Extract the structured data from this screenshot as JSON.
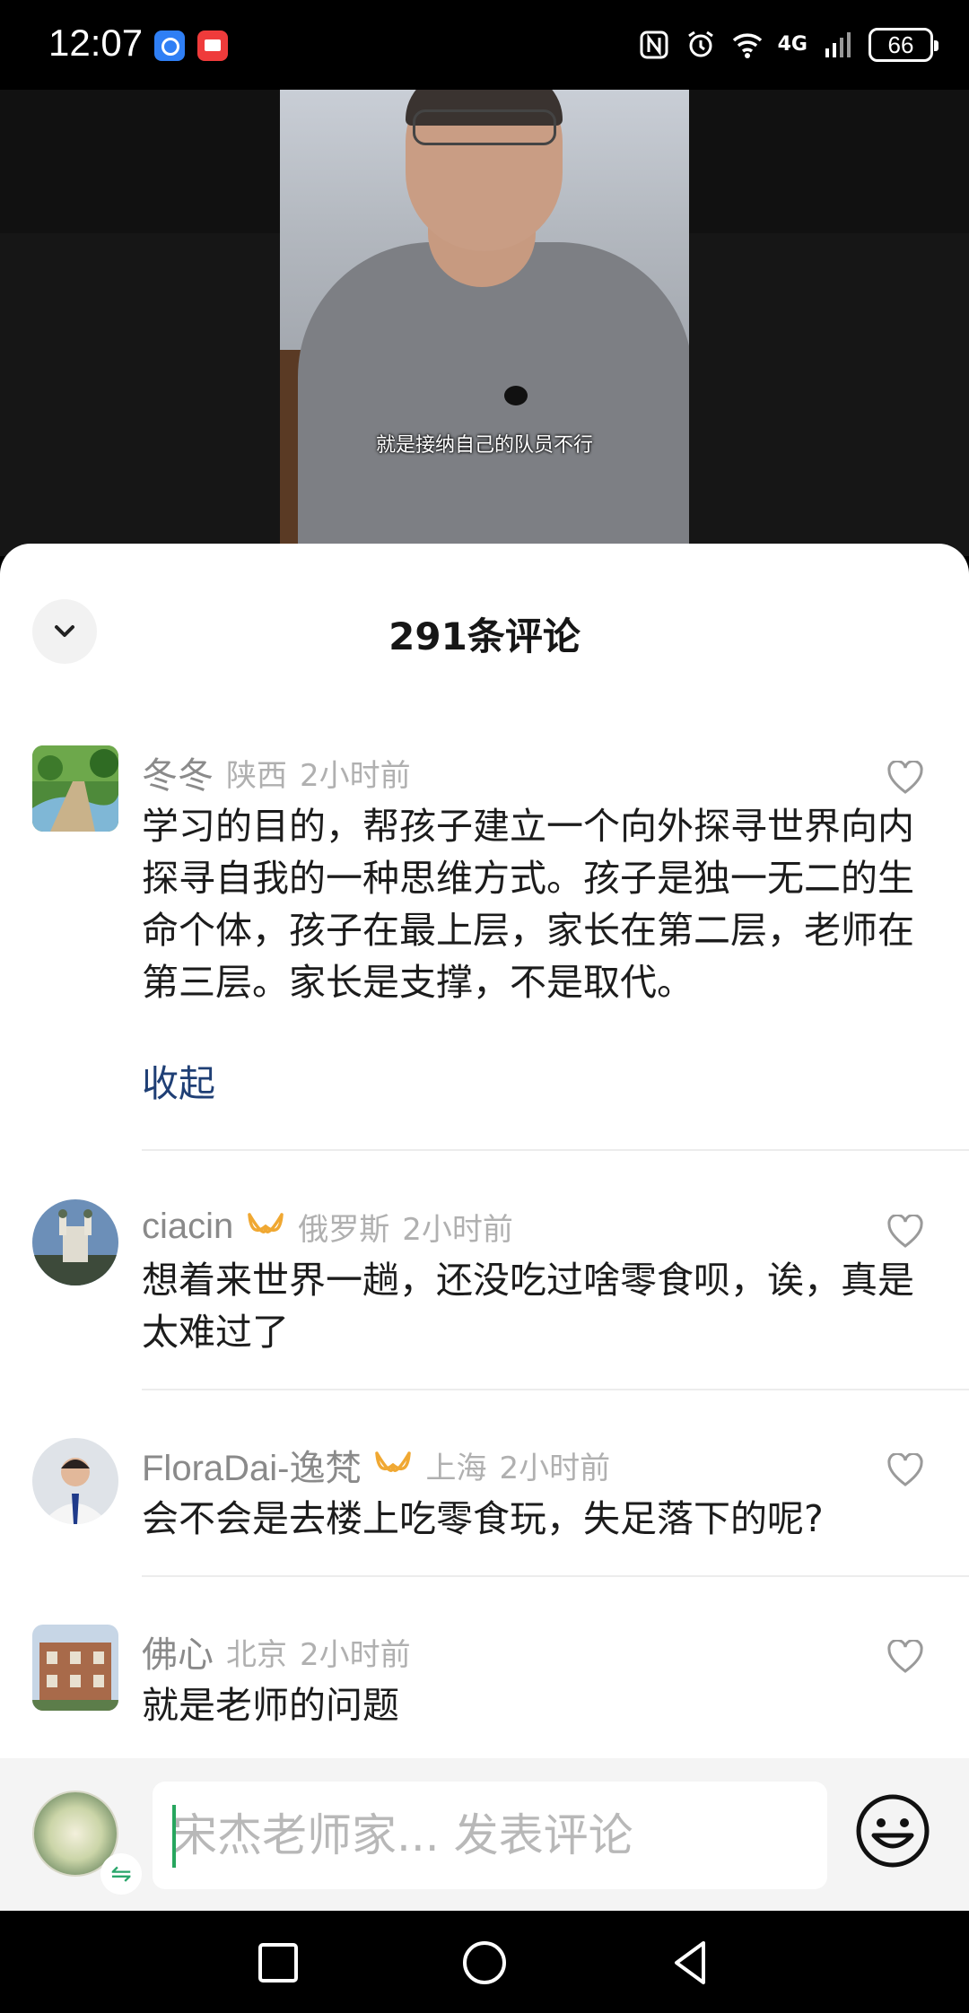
{
  "status_bar": {
    "time": "12:07",
    "network": "4G",
    "battery": "66"
  },
  "video": {
    "subtitle": "就是接纳自己的队员不行"
  },
  "comments_panel": {
    "title": "291条评论",
    "collapse_label": "收起",
    "comments": [
      {
        "name": "冬冬",
        "location": "陕西",
        "time": "2小时前",
        "text": "学习的目的，帮孩子建立一个向外探寻世界向内探寻自我的一种思维方式。孩子是独一无二的生命个体，孩子在最上层，家长在第二层，老师在第三层。家长是支撑，不是取代。"
      },
      {
        "name": "ciacin",
        "location": "俄罗斯",
        "time": "2小时前",
        "text": "想着来世界一趟，还没吃过啥零食呗，诶，真是太难过了"
      },
      {
        "name": "FloraDai-逸梵",
        "location": "上海",
        "time": "2小时前",
        "text": "会不会是去楼上吃零食玩，失足落下的呢?"
      },
      {
        "name": "佛心",
        "location": "北京",
        "time": "2小时前",
        "text": "就是老师的问题"
      }
    ]
  },
  "input_bar": {
    "placeholder": "宋杰老师家... 发表评论",
    "switch_glyph": "⇋"
  },
  "colors": {
    "accent_green": "#27a65e",
    "link_blue": "#1f3f75",
    "badge_gold": "#f0a832"
  }
}
